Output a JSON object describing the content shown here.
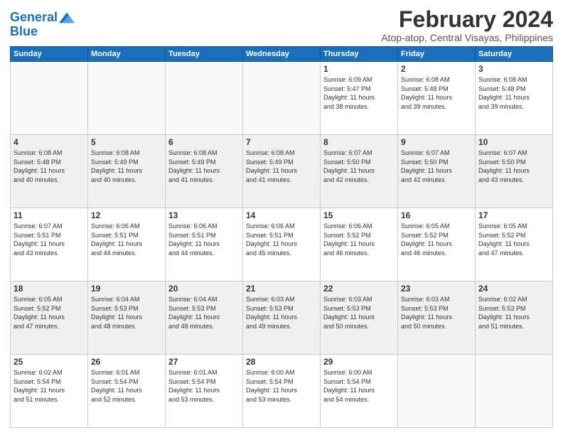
{
  "logo": {
    "line1": "General",
    "line2": "Blue"
  },
  "title": "February 2024",
  "subtitle": "Atop-atop, Central Visayas, Philippines",
  "headers": [
    "Sunday",
    "Monday",
    "Tuesday",
    "Wednesday",
    "Thursday",
    "Friday",
    "Saturday"
  ],
  "weeks": [
    [
      {
        "day": "",
        "info": ""
      },
      {
        "day": "",
        "info": ""
      },
      {
        "day": "",
        "info": ""
      },
      {
        "day": "",
        "info": ""
      },
      {
        "day": "1",
        "info": "Sunrise: 6:09 AM\nSunset: 5:47 PM\nDaylight: 11 hours\nand 38 minutes."
      },
      {
        "day": "2",
        "info": "Sunrise: 6:08 AM\nSunset: 5:48 PM\nDaylight: 11 hours\nand 39 minutes."
      },
      {
        "day": "3",
        "info": "Sunrise: 6:08 AM\nSunset: 5:48 PM\nDaylight: 11 hours\nand 39 minutes."
      }
    ],
    [
      {
        "day": "4",
        "info": "Sunrise: 6:08 AM\nSunset: 5:48 PM\nDaylight: 11 hours\nand 40 minutes."
      },
      {
        "day": "5",
        "info": "Sunrise: 6:08 AM\nSunset: 5:49 PM\nDaylight: 11 hours\nand 40 minutes."
      },
      {
        "day": "6",
        "info": "Sunrise: 6:08 AM\nSunset: 5:49 PM\nDaylight: 11 hours\nand 41 minutes."
      },
      {
        "day": "7",
        "info": "Sunrise: 6:08 AM\nSunset: 5:49 PM\nDaylight: 11 hours\nand 41 minutes."
      },
      {
        "day": "8",
        "info": "Sunrise: 6:07 AM\nSunset: 5:50 PM\nDaylight: 11 hours\nand 42 minutes."
      },
      {
        "day": "9",
        "info": "Sunrise: 6:07 AM\nSunset: 5:50 PM\nDaylight: 11 hours\nand 42 minutes."
      },
      {
        "day": "10",
        "info": "Sunrise: 6:07 AM\nSunset: 5:50 PM\nDaylight: 11 hours\nand 43 minutes."
      }
    ],
    [
      {
        "day": "11",
        "info": "Sunrise: 6:07 AM\nSunset: 5:51 PM\nDaylight: 11 hours\nand 43 minutes."
      },
      {
        "day": "12",
        "info": "Sunrise: 6:06 AM\nSunset: 5:51 PM\nDaylight: 11 hours\nand 44 minutes."
      },
      {
        "day": "13",
        "info": "Sunrise: 6:06 AM\nSunset: 5:51 PM\nDaylight: 11 hours\nand 44 minutes."
      },
      {
        "day": "14",
        "info": "Sunrise: 6:06 AM\nSunset: 5:51 PM\nDaylight: 11 hours\nand 45 minutes."
      },
      {
        "day": "15",
        "info": "Sunrise: 6:06 AM\nSunset: 5:52 PM\nDaylight: 11 hours\nand 46 minutes."
      },
      {
        "day": "16",
        "info": "Sunrise: 6:05 AM\nSunset: 5:52 PM\nDaylight: 11 hours\nand 46 minutes."
      },
      {
        "day": "17",
        "info": "Sunrise: 6:05 AM\nSunset: 5:52 PM\nDaylight: 11 hours\nand 47 minutes."
      }
    ],
    [
      {
        "day": "18",
        "info": "Sunrise: 6:05 AM\nSunset: 5:52 PM\nDaylight: 11 hours\nand 47 minutes."
      },
      {
        "day": "19",
        "info": "Sunrise: 6:04 AM\nSunset: 5:53 PM\nDaylight: 11 hours\nand 48 minutes."
      },
      {
        "day": "20",
        "info": "Sunrise: 6:04 AM\nSunset: 5:53 PM\nDaylight: 11 hours\nand 48 minutes."
      },
      {
        "day": "21",
        "info": "Sunrise: 6:03 AM\nSunset: 5:53 PM\nDaylight: 11 hours\nand 49 minutes."
      },
      {
        "day": "22",
        "info": "Sunrise: 6:03 AM\nSunset: 5:53 PM\nDaylight: 11 hours\nand 50 minutes."
      },
      {
        "day": "23",
        "info": "Sunrise: 6:03 AM\nSunset: 5:53 PM\nDaylight: 11 hours\nand 50 minutes."
      },
      {
        "day": "24",
        "info": "Sunrise: 6:02 AM\nSunset: 5:53 PM\nDaylight: 11 hours\nand 51 minutes."
      }
    ],
    [
      {
        "day": "25",
        "info": "Sunrise: 6:02 AM\nSunset: 5:54 PM\nDaylight: 11 hours\nand 51 minutes."
      },
      {
        "day": "26",
        "info": "Sunrise: 6:01 AM\nSunset: 5:54 PM\nDaylight: 11 hours\nand 52 minutes."
      },
      {
        "day": "27",
        "info": "Sunrise: 6:01 AM\nSunset: 5:54 PM\nDaylight: 11 hours\nand 53 minutes."
      },
      {
        "day": "28",
        "info": "Sunrise: 6:00 AM\nSunset: 5:54 PM\nDaylight: 11 hours\nand 53 minutes."
      },
      {
        "day": "29",
        "info": "Sunrise: 6:00 AM\nSunset: 5:54 PM\nDaylight: 11 hours\nand 54 minutes."
      },
      {
        "day": "",
        "info": ""
      },
      {
        "day": "",
        "info": ""
      }
    ]
  ]
}
